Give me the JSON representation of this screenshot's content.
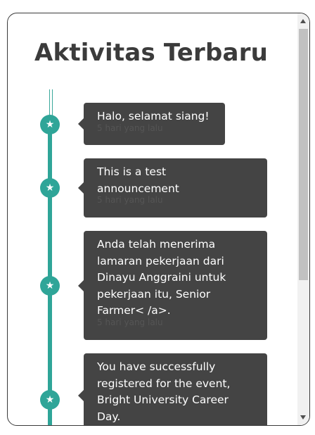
{
  "header": {
    "title": "Aktivitas Terbaru"
  },
  "timeline": {
    "marker_icon": "star-icon",
    "marker_glyph": "★",
    "accent_color": "#2fa598",
    "card_color": "#444444",
    "items": [
      {
        "message": "Halo, selamat siang!",
        "time": "5 hari yang lalu"
      },
      {
        "message": "This is a test announcement",
        "time": "5 hari yang lalu"
      },
      {
        "message": "Anda telah menerima lamaran pekerjaan dari Dinayu Anggraini untuk pekerjaan itu, Senior Farmer< /a>.",
        "time": "5 hari yang lalu"
      },
      {
        "message": "You have successfully registered for the event, Bright University Career Day.",
        "time": ""
      }
    ]
  }
}
